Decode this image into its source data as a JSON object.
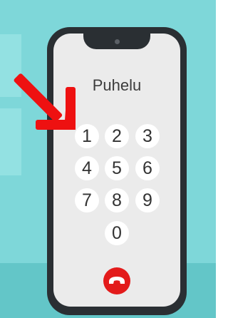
{
  "screen": {
    "title": "Puhelu"
  },
  "keypad": {
    "keys": [
      "1",
      "2",
      "3",
      "4",
      "5",
      "6",
      "7",
      "8",
      "9",
      "0"
    ]
  },
  "icons": {
    "end_call": "phone-hangup-icon",
    "pointer": "red-arrow-icon"
  },
  "colors": {
    "background": "#7ed7d9",
    "phone_body": "#2a2f33",
    "screen": "#ebebeb",
    "key": "#ffffff",
    "end_call": "#e31b1b",
    "arrow": "#ee1111"
  }
}
